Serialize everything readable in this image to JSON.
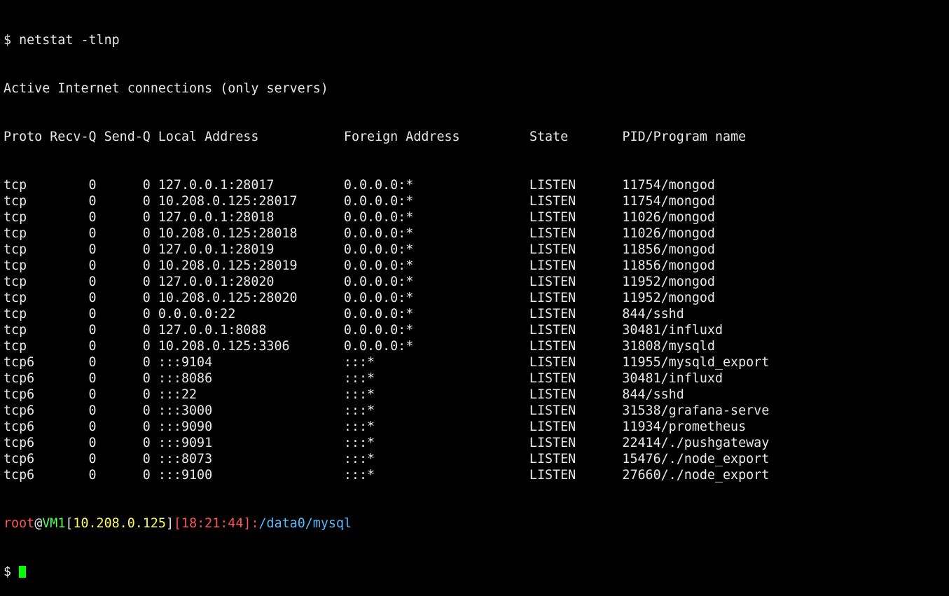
{
  "command_line": "$ netstat -tlnp",
  "summary": "Active Internet connections (only servers)",
  "headers": {
    "proto_recv_send": "Proto Recv-Q Send-Q",
    "local": "Local Address",
    "foreign": "Foreign Address",
    "state": "State",
    "pid": "PID/Program name"
  },
  "rows": [
    {
      "proto": "tcp",
      "recv": "0",
      "send": "0",
      "local": "127.0.0.1:28017",
      "foreign": "0.0.0.0:*",
      "state": "LISTEN",
      "pid": "11754/mongod"
    },
    {
      "proto": "tcp",
      "recv": "0",
      "send": "0",
      "local": "10.208.0.125:28017",
      "foreign": "0.0.0.0:*",
      "state": "LISTEN",
      "pid": "11754/mongod"
    },
    {
      "proto": "tcp",
      "recv": "0",
      "send": "0",
      "local": "127.0.0.1:28018",
      "foreign": "0.0.0.0:*",
      "state": "LISTEN",
      "pid": "11026/mongod"
    },
    {
      "proto": "tcp",
      "recv": "0",
      "send": "0",
      "local": "10.208.0.125:28018",
      "foreign": "0.0.0.0:*",
      "state": "LISTEN",
      "pid": "11026/mongod"
    },
    {
      "proto": "tcp",
      "recv": "0",
      "send": "0",
      "local": "127.0.0.1:28019",
      "foreign": "0.0.0.0:*",
      "state": "LISTEN",
      "pid": "11856/mongod"
    },
    {
      "proto": "tcp",
      "recv": "0",
      "send": "0",
      "local": "10.208.0.125:28019",
      "foreign": "0.0.0.0:*",
      "state": "LISTEN",
      "pid": "11856/mongod"
    },
    {
      "proto": "tcp",
      "recv": "0",
      "send": "0",
      "local": "127.0.0.1:28020",
      "foreign": "0.0.0.0:*",
      "state": "LISTEN",
      "pid": "11952/mongod"
    },
    {
      "proto": "tcp",
      "recv": "0",
      "send": "0",
      "local": "10.208.0.125:28020",
      "foreign": "0.0.0.0:*",
      "state": "LISTEN",
      "pid": "11952/mongod"
    },
    {
      "proto": "tcp",
      "recv": "0",
      "send": "0",
      "local": "0.0.0.0:22",
      "foreign": "0.0.0.0:*",
      "state": "LISTEN",
      "pid": "844/sshd"
    },
    {
      "proto": "tcp",
      "recv": "0",
      "send": "0",
      "local": "127.0.0.1:8088",
      "foreign": "0.0.0.0:*",
      "state": "LISTEN",
      "pid": "30481/influxd"
    },
    {
      "proto": "tcp",
      "recv": "0",
      "send": "0",
      "local": "10.208.0.125:3306",
      "foreign": "0.0.0.0:*",
      "state": "LISTEN",
      "pid": "31808/mysqld"
    },
    {
      "proto": "tcp6",
      "recv": "0",
      "send": "0",
      "local": ":::9104",
      "foreign": ":::*",
      "state": "LISTEN",
      "pid": "11955/mysqld_export"
    },
    {
      "proto": "tcp6",
      "recv": "0",
      "send": "0",
      "local": ":::8086",
      "foreign": ":::*",
      "state": "LISTEN",
      "pid": "30481/influxd"
    },
    {
      "proto": "tcp6",
      "recv": "0",
      "send": "0",
      "local": ":::22",
      "foreign": ":::*",
      "state": "LISTEN",
      "pid": "844/sshd"
    },
    {
      "proto": "tcp6",
      "recv": "0",
      "send": "0",
      "local": ":::3000",
      "foreign": ":::*",
      "state": "LISTEN",
      "pid": "31538/grafana-serve"
    },
    {
      "proto": "tcp6",
      "recv": "0",
      "send": "0",
      "local": ":::9090",
      "foreign": ":::*",
      "state": "LISTEN",
      "pid": "11934/prometheus"
    },
    {
      "proto": "tcp6",
      "recv": "0",
      "send": "0",
      "local": ":::9091",
      "foreign": ":::*",
      "state": "LISTEN",
      "pid": "22414/./pushgateway"
    },
    {
      "proto": "tcp6",
      "recv": "0",
      "send": "0",
      "local": ":::8073",
      "foreign": ":::*",
      "state": "LISTEN",
      "pid": "15476/./node_export"
    },
    {
      "proto": "tcp6",
      "recv": "0",
      "send": "0",
      "local": ":::9100",
      "foreign": ":::*",
      "state": "LISTEN",
      "pid": "27660/./node_export"
    }
  ],
  "prompt": {
    "user": "root",
    "at": "@",
    "host": "VM1",
    "lb1": "[",
    "ip": "10.208.0.125",
    "rb1": "]",
    "lb2": "[",
    "time": "18:21:44",
    "rb2": "]",
    "colon": ":",
    "path": "/data0/mysql",
    "dollar": "$ "
  },
  "colors": {
    "user": "#ff5555",
    "host": "#55ff55",
    "ip": "#ffff55",
    "time": "#ff5555",
    "path": "#55bbff",
    "cursor": "#00ff00"
  }
}
